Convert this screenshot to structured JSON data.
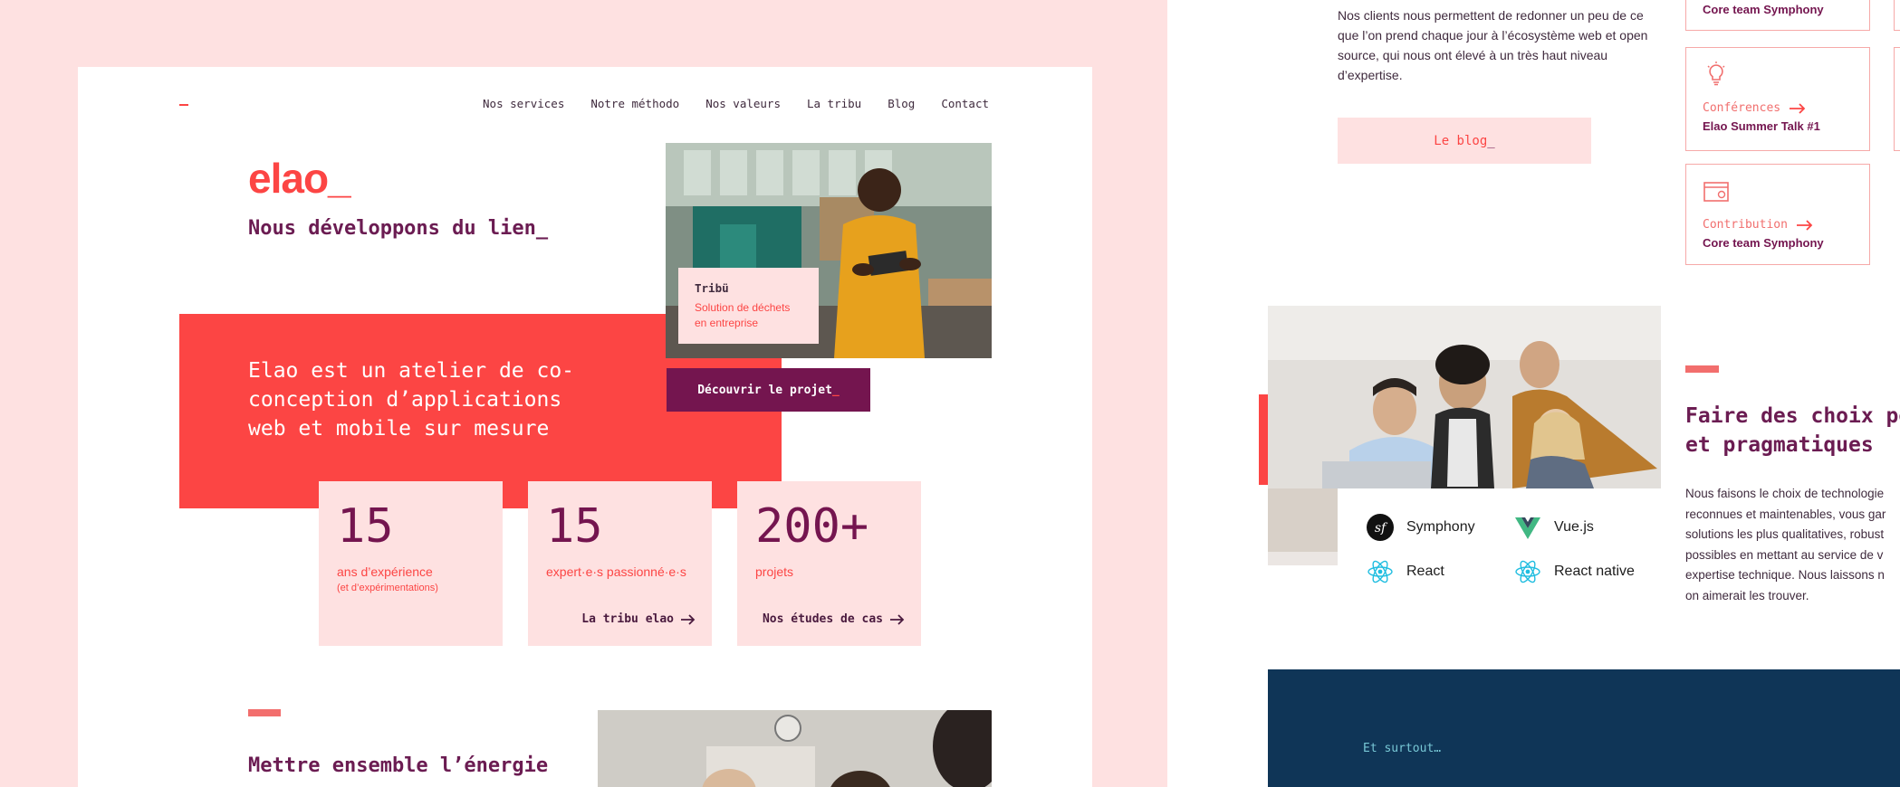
{
  "nav": {
    "items": [
      "Nos services",
      "Notre méthodo",
      "Nos valeurs",
      "La tribu",
      "Blog",
      "Contact"
    ]
  },
  "hero": {
    "logo": "elao_",
    "tagline": "Nous développons du lien_",
    "intro": "Elao est un atelier de co-conception d’applications web et mobile sur mesure"
  },
  "project_card": {
    "title": "Tribü",
    "description": "Solution de déchets en entreprise",
    "cta_label": "Découvrir le projet",
    "cta_suffix": "_"
  },
  "stats": [
    {
      "number": "15",
      "label": "ans d’expérience",
      "sub": "(et d’expérimentations)",
      "link": ""
    },
    {
      "number": "15",
      "label": "expert·e·s passionné·e·s",
      "sub": "",
      "link": "La tribu elao"
    },
    {
      "number": "200+",
      "label": "projets",
      "sub": "",
      "link": "Nos études de cas"
    }
  ],
  "section2": {
    "title": "Mettre ensemble l’énergie"
  },
  "blog": {
    "text": "Nos clients nous permettent de redonner un peu de ce que l’on prend chaque jour à l’écosystème web et open source, qui nous ont élevé à un très haut niveau d’expertise.",
    "button_label": "Le blog",
    "button_suffix": "_"
  },
  "cards": [
    {
      "category": "",
      "title": "Core team Symphony",
      "icon": "none"
    },
    {
      "category": "Conférences",
      "title": "Elao Summer Talk #1",
      "icon": "lightbulb-icon"
    },
    {
      "category": "Contribution",
      "title": "Core team Symphony",
      "icon": "code-window-icon"
    }
  ],
  "technologies": [
    {
      "name": "Symphony",
      "icon": "symfony-icon"
    },
    {
      "name": "Vue.js",
      "icon": "vuejs-icon"
    },
    {
      "name": "React",
      "icon": "react-icon"
    },
    {
      "name": "React native",
      "icon": "react-native-icon"
    }
  ],
  "choices": {
    "title_line1": "Faire des choix pé",
    "title_line2": "et pragmatiques",
    "body_lines": [
      "Nous faisons le choix de technologie",
      "reconnues et maintenables, vous gar",
      "solutions les plus qualitatives, robust",
      "possibles en mettant au service de v",
      "expertise technique. Nous laissons n",
      "on aimerait les trouver."
    ]
  },
  "footer_block": {
    "label": "Et surtout…"
  },
  "colors": {
    "brand_red": "#fc4544",
    "plum": "#74154f",
    "pink_bg": "#fee1e1",
    "navy": "#0f3557",
    "teal_text": "#78c8d6"
  }
}
